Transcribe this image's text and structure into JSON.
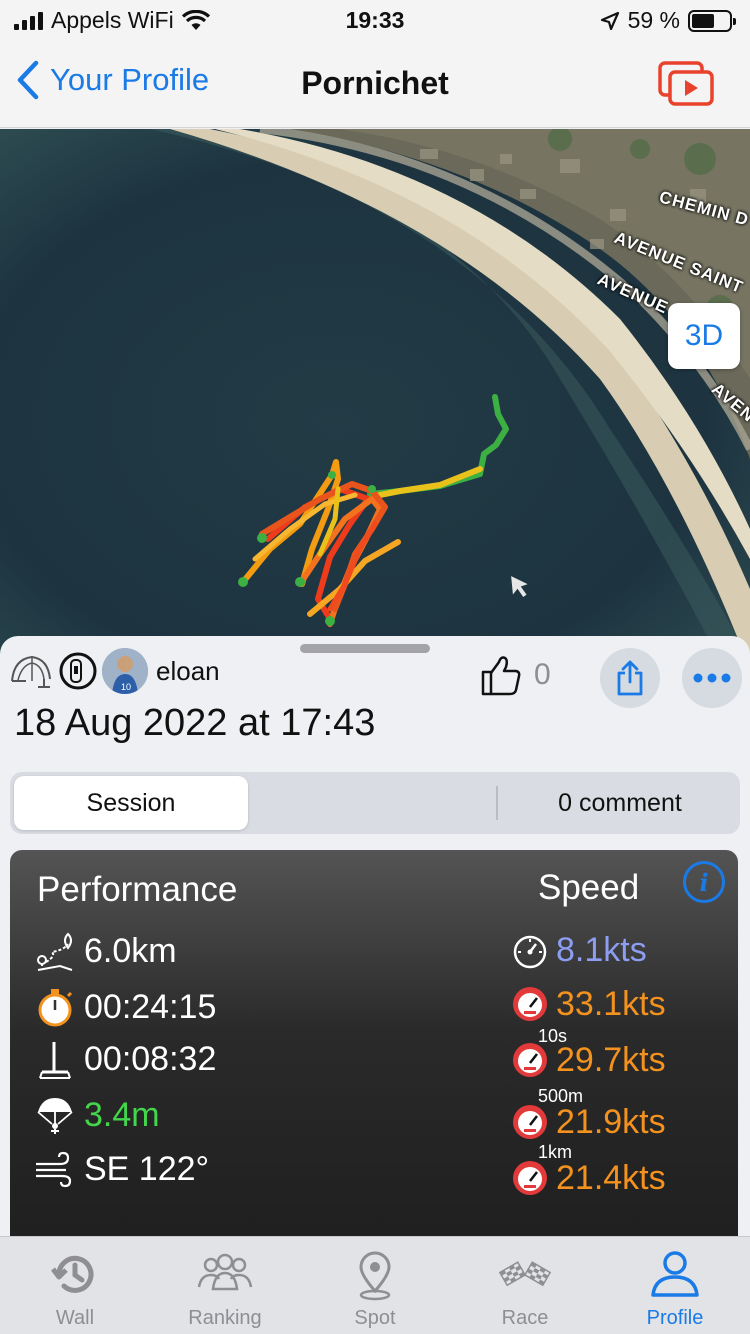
{
  "status_bar": {
    "carrier": "Appels WiFi",
    "time": "19:33",
    "battery": "59 %"
  },
  "nav": {
    "back_label": "Your Profile",
    "title": "Pornichet",
    "video_icon": "play-video-icon"
  },
  "map": {
    "streets": [
      "CHEMIN D",
      "AVENUE SAINT",
      "AVENUE",
      "AVEN"
    ],
    "btn_3d": "3D",
    "route_colors": [
      "#3cb043",
      "#e8c21a",
      "#f39c12",
      "#ee3b1c"
    ]
  },
  "session": {
    "user_name": "eloan",
    "likes": "0",
    "date": "18 Aug 2022 at 17:43",
    "tabs": {
      "session": "Session",
      "comments": "0 comment"
    }
  },
  "performance": {
    "title": "Performance",
    "speed_title": "Speed",
    "distance": "6.0km",
    "duration": "00:24:15",
    "foil_time": "00:08:32",
    "kite_size": "3.4m",
    "wind": "SE 122°",
    "speeds": {
      "avg": "8.1kts",
      "max": "33.1kts",
      "s10_label": "10s",
      "s10": "29.7kts",
      "m500_label": "500m",
      "m500": "21.9kts",
      "km1_label": "1km",
      "km1": "21.4kts"
    },
    "colors": {
      "accent": "#1a7ae6",
      "speed": "#f3921e",
      "avg": "#8c9df2",
      "kite": "#43d64c"
    }
  },
  "tabbar": {
    "items": [
      {
        "label": "Wall",
        "icon": "history-icon"
      },
      {
        "label": "Ranking",
        "icon": "people-icon"
      },
      {
        "label": "Spot",
        "icon": "location-pin-icon"
      },
      {
        "label": "Race",
        "icon": "checkered-flags-icon"
      },
      {
        "label": "Profile",
        "icon": "person-icon"
      }
    ]
  }
}
